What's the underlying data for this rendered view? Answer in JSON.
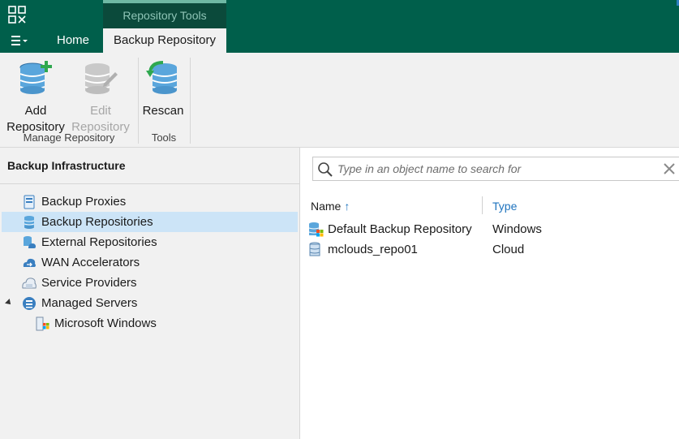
{
  "header": {
    "context_tab": "Repository Tools",
    "tabs": [
      {
        "label": "Home",
        "active": false
      },
      {
        "label": "Backup Repository",
        "active": true
      }
    ],
    "menu_icon": "hamburger-menu-icon"
  },
  "ribbon": {
    "buttons": [
      {
        "label_line1": "Add",
        "label_line2": "Repository",
        "enabled": true,
        "icon": "add-repository-icon"
      },
      {
        "label_line1": "Edit",
        "label_line2": "Repository",
        "enabled": false,
        "icon": "edit-repository-icon"
      },
      {
        "label_line1": "Rescan",
        "label_line2": "",
        "enabled": true,
        "icon": "rescan-icon"
      }
    ],
    "groups": [
      {
        "label": "Manage Repository"
      },
      {
        "label": "Tools"
      }
    ]
  },
  "sidebar": {
    "title": "Backup Infrastructure",
    "items": [
      {
        "label": "Backup Proxies",
        "icon": "backup-proxy-icon",
        "selected": false
      },
      {
        "label": "Backup Repositories",
        "icon": "backup-repository-icon",
        "selected": true
      },
      {
        "label": "External Repositories",
        "icon": "external-repository-icon",
        "selected": false
      },
      {
        "label": "WAN Accelerators",
        "icon": "wan-accelerator-icon",
        "selected": false
      },
      {
        "label": "Service Providers",
        "icon": "service-provider-icon",
        "selected": false
      },
      {
        "label": "Managed Servers",
        "icon": "managed-servers-icon",
        "selected": false,
        "expanded": true
      },
      {
        "label": "Microsoft Windows",
        "icon": "windows-server-icon",
        "selected": false
      }
    ]
  },
  "main": {
    "search": {
      "placeholder": "Type in an object name to search for"
    },
    "columns": [
      {
        "label": "Name",
        "sorted": "ascending"
      },
      {
        "label": "Type"
      }
    ],
    "rows": [
      {
        "name": "Default Backup Repository",
        "type": "Windows",
        "icon": "windows-repository-icon"
      },
      {
        "name": "mclouds_repo01",
        "type": "Cloud",
        "icon": "cloud-repository-icon"
      }
    ]
  },
  "colors": {
    "header_green": "#005f4b",
    "context_tab": "#0b4a3b",
    "ribbon_bg": "#f1f1f1",
    "selection": "#cce4f7",
    "link_blue": "#1e73be"
  }
}
